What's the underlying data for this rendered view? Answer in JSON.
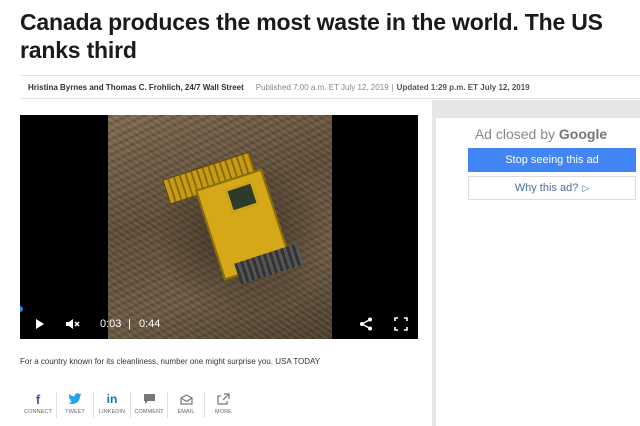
{
  "article": {
    "headline": "Canada produces the most waste in the world. The US ranks third",
    "authors": "Hristina Byrnes and Thomas C. Frohlich, 24/7 Wall Street",
    "published": "Published 7:00 a.m. ET July 12, 2019",
    "separator": "|",
    "updated": "Updated 1:29 p.m. ET July 12, 2019",
    "caption": "For a country known for its cleanliness, number one might surprise you. USA TODAY"
  },
  "video": {
    "current_time": "0:03",
    "time_separator": "|",
    "total_time": "0:44",
    "progress": 0.07,
    "icons": [
      "play-icon",
      "mute-icon",
      "share-icon",
      "fullscreen-icon"
    ]
  },
  "share": {
    "items": [
      {
        "label": "CONNECT",
        "icon": "facebook-icon",
        "glyph": "f",
        "color": "#3b5998"
      },
      {
        "label": "TWEET",
        "icon": "twitter-icon",
        "glyph": "🐦",
        "color": "#1da1f2"
      },
      {
        "label": "LINKEDIN",
        "icon": "linkedin-icon",
        "glyph": "in",
        "color": "#0077b5"
      },
      {
        "label": "COMMENT",
        "icon": "comment-icon",
        "glyph": "💬",
        "color": "#777777"
      },
      {
        "label": "EMAIL",
        "icon": "email-icon",
        "glyph": "✉",
        "color": "#777777"
      },
      {
        "label": "MORE",
        "icon": "more-icon",
        "glyph": "↗",
        "color": "#777777"
      }
    ]
  },
  "ad": {
    "closed_text": "Ad closed by",
    "brand": "Google",
    "stop_label": "Stop seeing this ad",
    "why_label": "Why this ad?",
    "why_icon": "ad-choices-icon",
    "button_color": "#4285f4"
  }
}
